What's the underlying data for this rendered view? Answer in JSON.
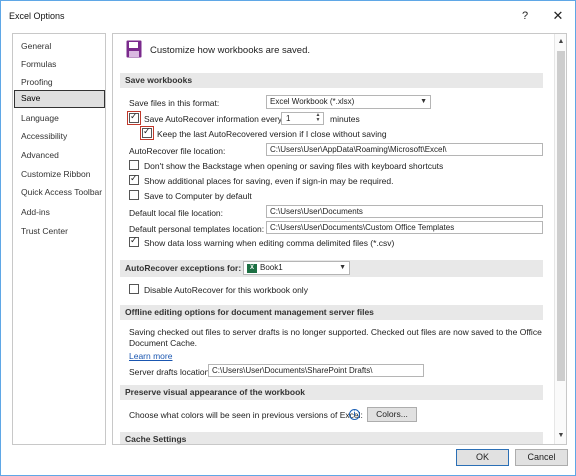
{
  "window": {
    "title": "Excel Options",
    "help": "?",
    "close": "✕"
  },
  "sidebar": {
    "items": [
      {
        "label": "General"
      },
      {
        "label": "Formulas"
      },
      {
        "label": "Proofing"
      },
      {
        "label": "Save",
        "active": true
      },
      {
        "label": "Language"
      },
      {
        "label": "Accessibility"
      },
      {
        "label": "Advanced"
      },
      {
        "label": "Customize Ribbon"
      },
      {
        "label": "Quick Access Toolbar"
      },
      {
        "label": "Add-ins"
      },
      {
        "label": "Trust Center"
      }
    ]
  },
  "content": {
    "header": "Customize how workbooks are saved.",
    "save_workbooks": {
      "section_title": "Save workbooks",
      "format_label": "Save files in this format:",
      "format_value": "Excel Workbook (*.xlsx)",
      "autorecover_label": "Save AutoRecover information every",
      "autorecover_minutes": "1",
      "minutes_label": "minutes",
      "keep_last_label": "Keep the last AutoRecovered version if I close without saving",
      "ar_location_label": "AutoRecover file location:",
      "ar_location_value": "C:\\Users\\User\\AppData\\Roaming\\Microsoft\\Excel\\",
      "backstage_label": "Don't show the Backstage when opening or saving files with keyboard shortcuts",
      "additional_places_label": "Show additional places for saving, even if sign-in may be required.",
      "save_computer_label": "Save to Computer by default",
      "default_local_label": "Default local file location:",
      "default_local_value": "C:\\Users\\User\\Documents",
      "personal_templates_label": "Default personal templates location:",
      "personal_templates_value": "C:\\Users\\User\\Documents\\Custom Office Templates",
      "data_loss_label": "Show data loss warning when editing comma delimited files (*.csv)"
    },
    "exceptions": {
      "section_title": "AutoRecover exceptions for:",
      "workbook": "Book1",
      "disable_label": "Disable AutoRecover for this workbook only"
    },
    "offline": {
      "section_title": "Offline editing options for document management server files",
      "description_line1": "Saving checked out files to server drafts is no longer supported. Checked out files are now saved to the Office",
      "description_line2": "Document Cache.",
      "learn_more": "Learn more",
      "drafts_label": "Server drafts location:",
      "drafts_value": "C:\\Users\\User\\Documents\\SharePoint Drafts\\"
    },
    "preserve": {
      "section_title": "Preserve visual appearance of the workbook",
      "colors_label": "Choose what colors will be seen in previous versions of Excel:",
      "colors_button": "Colors..."
    },
    "cache": {
      "section_title": "Cache Settings"
    }
  },
  "footer": {
    "ok": "OK",
    "cancel": "Cancel"
  },
  "colors": {
    "accent": "#2b6fb5",
    "highlight_box": "#c0392b",
    "save_icon": "#7a2a8c",
    "excel_green": "#1d7044"
  }
}
